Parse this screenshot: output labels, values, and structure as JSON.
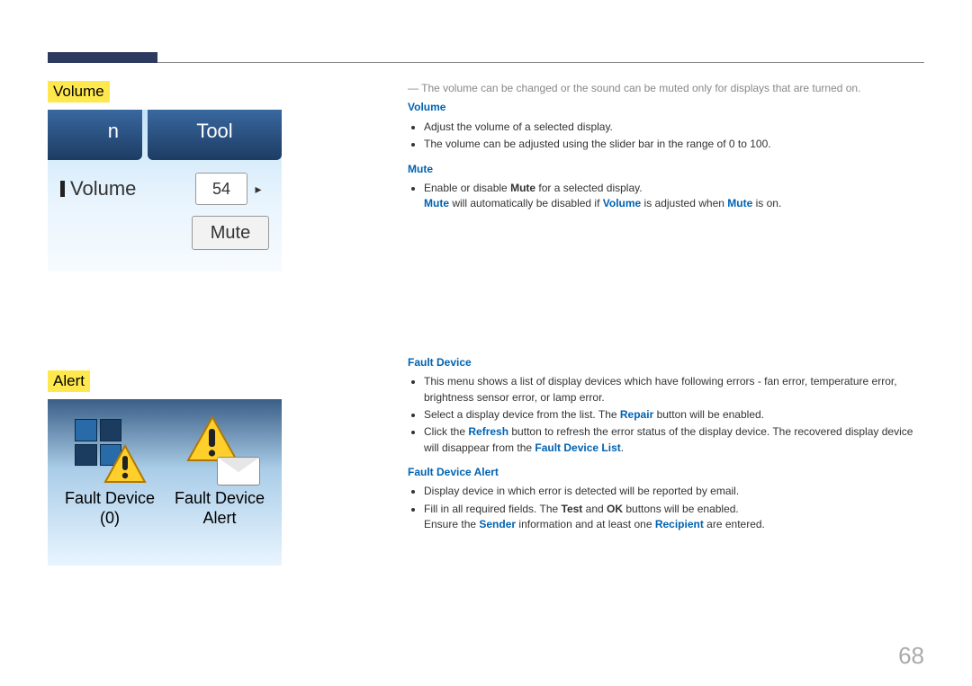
{
  "headings": {
    "volume": "Volume",
    "alert": "Alert"
  },
  "volume_shot": {
    "tab_left": "n",
    "tab_right": "Tool",
    "label": "Volume",
    "value": "54",
    "mute_btn": "Mute"
  },
  "alert_shot": {
    "fault_device_label": "Fault Device\n(0)",
    "fault_alert_label": "Fault Device\nAlert"
  },
  "vol_section": {
    "note_dash": "― ",
    "note": "The volume can be changed or the sound can be muted only for displays that are turned on.",
    "sub_volume": "Volume",
    "vol_b1": "Adjust the volume of a selected display.",
    "vol_b2": "The volume can be adjusted using the slider bar in the range of 0 to 100.",
    "sub_mute": "Mute",
    "mute_b1_pre": "Enable or disable ",
    "mute_b1_kw": "Mute",
    "mute_b1_post": " for a selected display.",
    "mute_b2_kw1": "Mute",
    "mute_b2_mid": " will automatically be disabled if ",
    "mute_b2_kw2": "Volume",
    "mute_b2_mid2": " is adjusted when ",
    "mute_b2_kw3": "Mute",
    "mute_b2_end": " is on."
  },
  "alert_section": {
    "sub_fault": "Fault Device",
    "fd_b1": "This menu shows a list of display devices which have following errors - fan error, temperature error, brightness sensor error, or lamp error.",
    "fd_b2_pre": "Select a display device from the list. The ",
    "fd_b2_kw": "Repair",
    "fd_b2_post": " button will be enabled.",
    "fd_b3_pre": "Click the ",
    "fd_b3_kw1": "Refresh",
    "fd_b3_mid": " button to refresh the error status of the display device. The recovered display device will disappear from the ",
    "fd_b3_kw2": "Fault Device List",
    "fd_b3_end": ".",
    "sub_fault_alert": "Fault Device Alert",
    "fa_b1": "Display device in which error is detected will be reported by email.",
    "fa_b2_pre": "Fill in all required fields. The ",
    "fa_b2_kw1": "Test",
    "fa_b2_mid": " and ",
    "fa_b2_kw2": "OK",
    "fa_b2_post": " buttons will be enabled.",
    "fa_b2_line2_pre": "Ensure the ",
    "fa_b2_line2_kw1": "Sender",
    "fa_b2_line2_mid": " information and at least one ",
    "fa_b2_line2_kw2": "Recipient",
    "fa_b2_line2_end": " are entered."
  },
  "page_number": "68"
}
